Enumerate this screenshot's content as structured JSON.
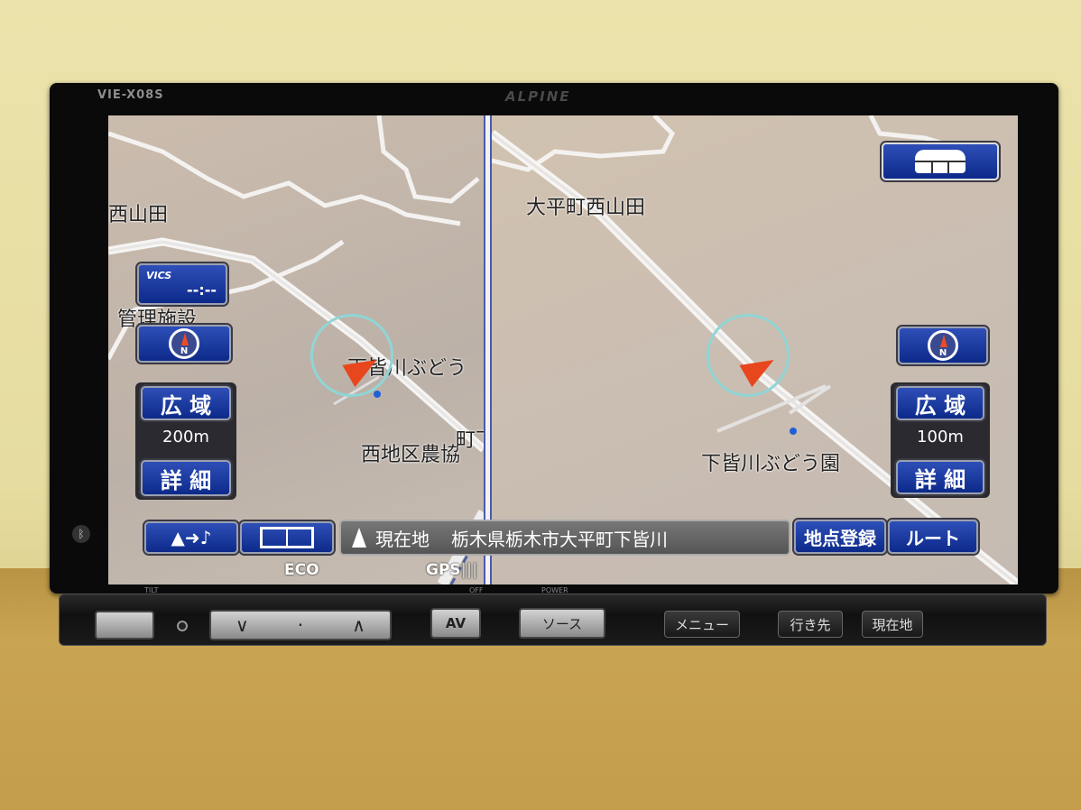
{
  "device": {
    "model": "VIE-X08S",
    "brand": "ALPINE"
  },
  "left_map": {
    "labels": [
      "西山田",
      "管理施設",
      "下皆川ぶどう",
      "西地区農協",
      "町下皆川"
    ],
    "vics": {
      "label": "VICS",
      "time": "--:--"
    },
    "zoom_out_label": "広 域",
    "scale": "200m",
    "zoom_in_label": "詳 細"
  },
  "right_map": {
    "labels": [
      "大平町西山田",
      "下皆川ぶどう園"
    ],
    "zoom_out_label": "広 域",
    "scale": "100m",
    "zoom_in_label": "詳 細"
  },
  "bottom_bar": {
    "nav_audio_label": "▲➜♪",
    "current_location_label": "現在地",
    "address": "栃木県栃木市大平町下皆川",
    "register_point_label": "地点登録",
    "route_label": "ルート",
    "eco": "ECO",
    "gps": "GPS"
  },
  "hardware": {
    "tilt": "TILT",
    "power": "POWER",
    "off": "OFF",
    "av": "AV",
    "source": "ソース",
    "menu": "メニュー",
    "destination": "行き先",
    "current": "現在地"
  },
  "colors": {
    "button_blue": "#1a3a9e",
    "vehicle_arrow": "#e8461c",
    "accuracy_circle": "#8fd6d6"
  }
}
